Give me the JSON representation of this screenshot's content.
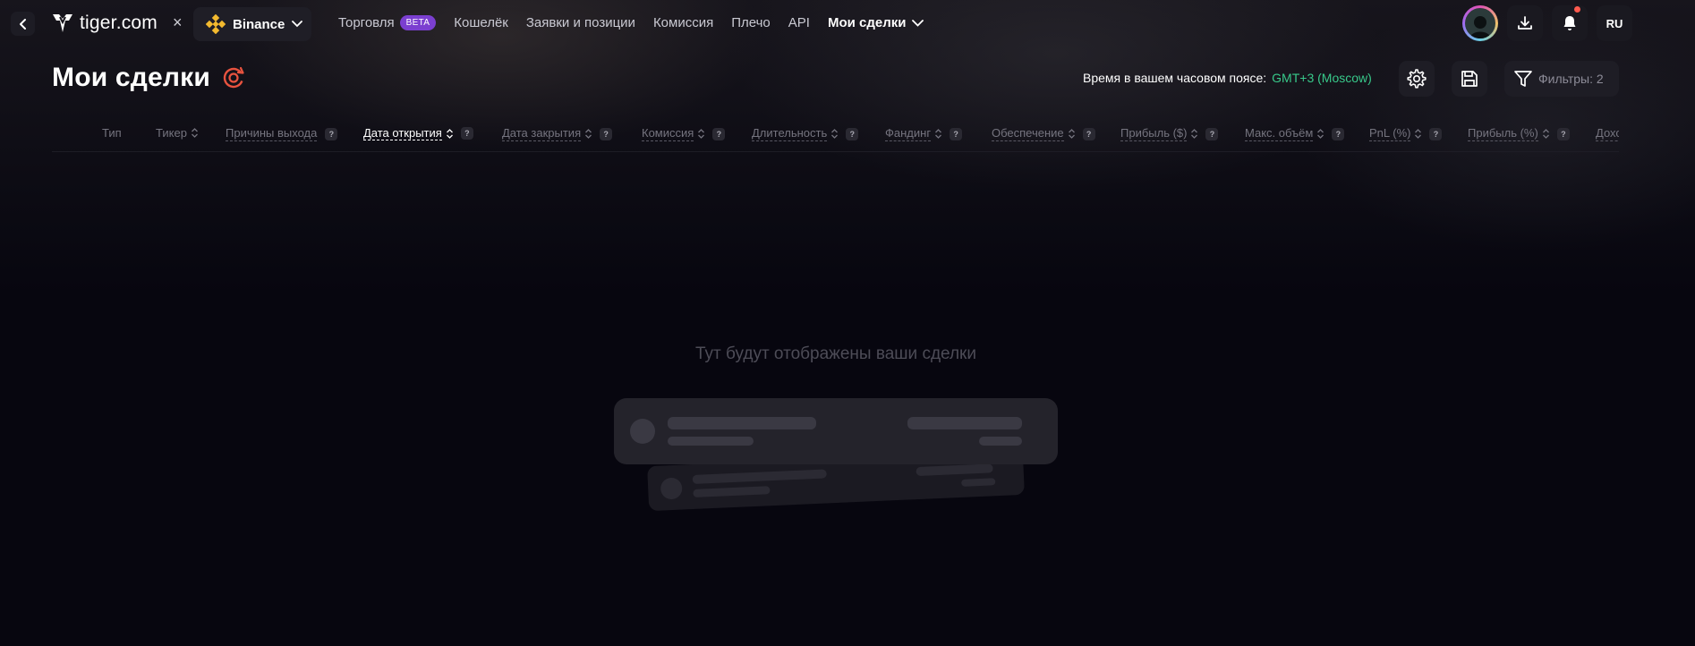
{
  "nav": {
    "logo_text": "tiger.com",
    "close_symbol": "×",
    "exchange": {
      "label": "Binance",
      "icon": "binance-icon"
    },
    "menu": [
      {
        "label": "Торговля",
        "badge": "BETA"
      },
      {
        "label": "Кошелёк"
      },
      {
        "label": "Заявки и позиции"
      },
      {
        "label": "Комиссия"
      },
      {
        "label": "Плечо"
      },
      {
        "label": "API"
      },
      {
        "label": "Мои сделки",
        "active": true
      }
    ],
    "language": "RU",
    "notification_dot_color": "#ff5a4e"
  },
  "page": {
    "title": "Мои сделки",
    "timezone_label": "Время в вашем часовом поясе:",
    "timezone_value": "GMT+3 (Moscow)",
    "filters_label": "Фильтры: 2"
  },
  "table": {
    "columns": [
      {
        "label": "Тип"
      },
      {
        "label": "Тикер",
        "sortable": true
      },
      {
        "label": "Причины выхода",
        "help": true
      },
      {
        "label": "Дата открытия",
        "sortable": true,
        "help": true,
        "active": true
      },
      {
        "label": "Дата закрытия",
        "sortable": true,
        "help": true
      },
      {
        "label": "Комиссия",
        "sortable": true,
        "help": true
      },
      {
        "label": "Длительность",
        "sortable": true,
        "help": true
      },
      {
        "label": "Фандинг",
        "sortable": true,
        "help": true
      },
      {
        "label": "Обеспечение",
        "sortable": true,
        "help": true
      },
      {
        "label": "Прибыль ($)",
        "sortable": true,
        "help": true
      },
      {
        "label": "Макс. объём",
        "sortable": true,
        "help": true
      },
      {
        "label": "PnL (%)",
        "sortable": true,
        "help": true
      },
      {
        "label": "Прибыль (%)",
        "sortable": true,
        "help": true
      },
      {
        "label": "Дохо"
      }
    ],
    "help_symbol": "?"
  },
  "empty_state": {
    "message": "Тут будут отображены ваши сделки"
  },
  "colors": {
    "accent_green": "#38c98a",
    "beta_badge": "#7b3fd0",
    "refresh_icon": "#e8533f"
  }
}
